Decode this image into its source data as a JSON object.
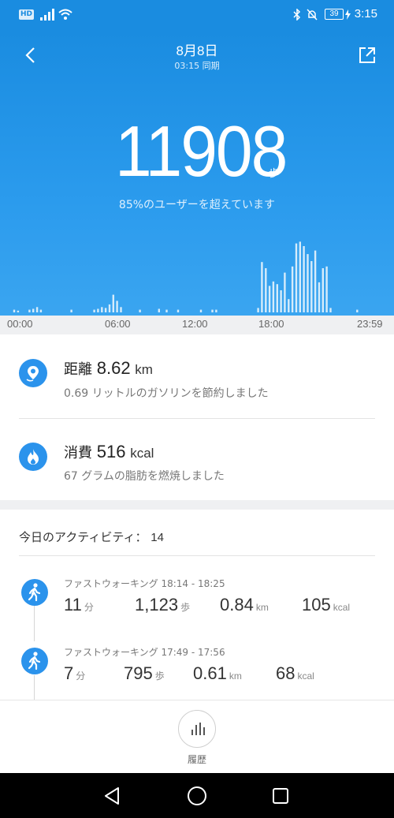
{
  "status_bar": {
    "hd_label": "HD",
    "battery": "39",
    "time": "3:15"
  },
  "header": {
    "date": "8月8日",
    "sync": "03:15 同期"
  },
  "summary": {
    "steps": "11908",
    "steps_unit": "歩",
    "beat_text": "85%のユーザーを超えています"
  },
  "chart_data": {
    "type": "bar",
    "title": "",
    "xlabel": "",
    "ylabel": "",
    "x_ticks": [
      "00:00",
      "06:00",
      "12:00",
      "18:00",
      "23:59"
    ],
    "x_range": [
      "00:00",
      "23:59"
    ],
    "grid": false,
    "color": "#d6ecfb",
    "bars": [
      {
        "t": "00:15",
        "v": 3
      },
      {
        "t": "00:30",
        "v": 2
      },
      {
        "t": "01:15",
        "v": 3
      },
      {
        "t": "01:30",
        "v": 4
      },
      {
        "t": "01:45",
        "v": 6
      },
      {
        "t": "02:00",
        "v": 3
      },
      {
        "t": "04:00",
        "v": 3
      },
      {
        "t": "05:30",
        "v": 3
      },
      {
        "t": "05:45",
        "v": 4
      },
      {
        "t": "06:00",
        "v": 6
      },
      {
        "t": "06:15",
        "v": 5
      },
      {
        "t": "06:30",
        "v": 9
      },
      {
        "t": "06:45",
        "v": 20
      },
      {
        "t": "07:00",
        "v": 13
      },
      {
        "t": "07:15",
        "v": 6
      },
      {
        "t": "08:30",
        "v": 3
      },
      {
        "t": "09:45",
        "v": 4
      },
      {
        "t": "10:15",
        "v": 3
      },
      {
        "t": "11:00",
        "v": 3
      },
      {
        "t": "12:30",
        "v": 3
      },
      {
        "t": "13:15",
        "v": 3
      },
      {
        "t": "13:30",
        "v": 3
      },
      {
        "t": "16:15",
        "v": 5
      },
      {
        "t": "16:30",
        "v": 57
      },
      {
        "t": "16:45",
        "v": 50
      },
      {
        "t": "17:00",
        "v": 30
      },
      {
        "t": "17:15",
        "v": 35
      },
      {
        "t": "17:30",
        "v": 32
      },
      {
        "t": "17:45",
        "v": 25
      },
      {
        "t": "18:00",
        "v": 45
      },
      {
        "t": "18:15",
        "v": 15
      },
      {
        "t": "18:30",
        "v": 52
      },
      {
        "t": "18:45",
        "v": 78
      },
      {
        "t": "19:00",
        "v": 80
      },
      {
        "t": "19:15",
        "v": 75
      },
      {
        "t": "19:30",
        "v": 66
      },
      {
        "t": "19:45",
        "v": 58
      },
      {
        "t": "20:00",
        "v": 70
      },
      {
        "t": "20:15",
        "v": 34
      },
      {
        "t": "20:30",
        "v": 50
      },
      {
        "t": "20:45",
        "v": 52
      },
      {
        "t": "21:00",
        "v": 5
      },
      {
        "t": "22:45",
        "v": 3
      }
    ]
  },
  "distance": {
    "label": "距離",
    "value": "8.62",
    "unit": "km",
    "desc": "0.69 リットルのガソリンを節約しました"
  },
  "calories": {
    "label": "消費",
    "value": "516",
    "unit": "kcal",
    "desc": "67 グラムの脂肪を燃焼しました"
  },
  "activities": {
    "title": "今日のアクティビティ：",
    "count": "14",
    "items": [
      {
        "title": "ファストウォーキング 18:14 - 18:25",
        "minutes": "11",
        "minutes_unit": "分",
        "steps": "1,123",
        "steps_unit": "歩",
        "distance": "0.84",
        "distance_unit": "km",
        "kcal": "105",
        "kcal_unit": "kcal"
      },
      {
        "title": "ファストウォーキング 17:49 - 17:56",
        "minutes": "7",
        "minutes_unit": "分",
        "steps": "795",
        "steps_unit": "歩",
        "distance": "0.61",
        "distance_unit": "km",
        "kcal": "68",
        "kcal_unit": "kcal"
      }
    ]
  },
  "bottom_nav": {
    "history_label": "履歴"
  },
  "colors": {
    "primary": "#1a8ce0",
    "accent": "#2b93ec",
    "bar": "#d6ecfb"
  }
}
